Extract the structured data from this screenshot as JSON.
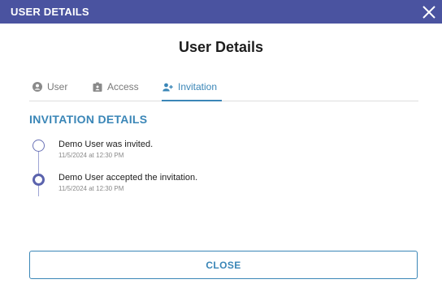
{
  "window": {
    "title": "USER DETAILS",
    "close_icon": "close-icon"
  },
  "page": {
    "heading": "User Details"
  },
  "tabs": [
    {
      "label": "User",
      "icon": "user-circle-icon",
      "active": false
    },
    {
      "label": "Access",
      "icon": "id-badge-icon",
      "active": false
    },
    {
      "label": "Invitation",
      "icon": "user-plus-icon",
      "active": true
    }
  ],
  "invitation": {
    "section_title": "INVITATION DETAILS",
    "events": [
      {
        "text": "Demo User was invited.",
        "date": "11/5/2024 at 12:30 PM"
      },
      {
        "text": "Demo User accepted the invitation.",
        "date": "11/5/2024 at 12:30 PM"
      }
    ]
  },
  "footer": {
    "close_label": "CLOSE"
  },
  "colors": {
    "titlebar": "#4a53a0",
    "accent": "#3a86b7",
    "timeline": "#5b63ad"
  }
}
